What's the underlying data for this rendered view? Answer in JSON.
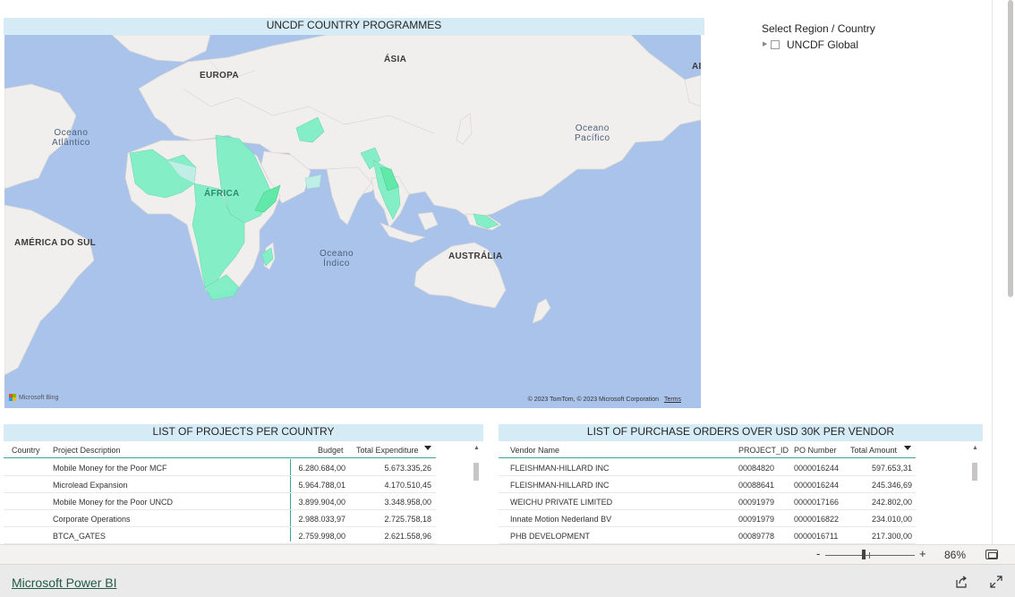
{
  "map": {
    "title": "UNCDF COUNTRY PROGRAMMES",
    "labels": {
      "europa": "EUROPA",
      "asia": "ÁSIA",
      "africa": "ÁFRICA",
      "south_america": "AMÉRICA DO SUL",
      "australia": "AUSTRÁLIA",
      "edge": "AI"
    },
    "oceans": {
      "atlantic": "Oceano\nAtlântico",
      "pacific": "Oceano\nPacífico",
      "indian": "Oceano\nÍndico"
    },
    "bing": "Microsoft Bing",
    "attribution": "© 2023 TomTom, © 2023 Microsoft Corporation",
    "terms": "Terms",
    "colors": {
      "water": "#a9c3eb",
      "land": "#f1efed",
      "programme": "#7ff0c4",
      "programme_strong": "#62e8a8"
    }
  },
  "slicer": {
    "title": "Select Region / Country",
    "items": [
      {
        "label": "UNCDF Global"
      }
    ]
  },
  "projects_table": {
    "title": "LIST OF PROJECTS PER COUNTRY",
    "columns": {
      "country": "Country",
      "description": "Project Description",
      "budget": "Budget",
      "expenditure": "Total Expenditure"
    },
    "rows": [
      {
        "country": "",
        "description": "Mobile Money for the Poor MCF",
        "budget": "6.280.684,00",
        "expenditure": "5.673.335,26"
      },
      {
        "country": "",
        "description": "Microlead Expansion",
        "budget": "5.964.788,01",
        "expenditure": "4.170.510,45"
      },
      {
        "country": "",
        "description": "Mobile Money for the Poor UNCD",
        "budget": "3.899.904,00",
        "expenditure": "3.348.958,00"
      },
      {
        "country": "",
        "description": "Corporate Operations",
        "budget": "2.988.033,97",
        "expenditure": "2.725.758,18"
      },
      {
        "country": "",
        "description": "BTCA_GATES",
        "budget": "2.759.998,00",
        "expenditure": "2.621.558,96"
      }
    ]
  },
  "po_table": {
    "title": "LIST OF PURCHASE ORDERS OVER USD 30K PER VENDOR",
    "columns": {
      "vendor": "Vendor Name",
      "project": "PROJECT_ID",
      "po": "PO Number",
      "amount": "Total Amount"
    },
    "rows": [
      {
        "vendor": "FLEISHMAN-HILLARD INC",
        "project": "00084820",
        "po": "0000016244",
        "amount": "597.653,31"
      },
      {
        "vendor": "FLEISHMAN-HILLARD INC",
        "project": "00088641",
        "po": "0000016244",
        "amount": "245.346,69"
      },
      {
        "vendor": "WEICHU PRIVATE LIMITED",
        "project": "00091979",
        "po": "0000017166",
        "amount": "242.802,00"
      },
      {
        "vendor": "Innate Motion Nederland BV",
        "project": "00091979",
        "po": "0000016822",
        "amount": "234.010,00"
      },
      {
        "vendor": "PHB DEVELOPMENT",
        "project": "00089778",
        "po": "0000016711",
        "amount": "217.300,00"
      }
    ]
  },
  "zoom": {
    "minus": "-",
    "plus": "+",
    "level": "86%"
  },
  "footer": {
    "brand": "Microsoft Power BI"
  }
}
